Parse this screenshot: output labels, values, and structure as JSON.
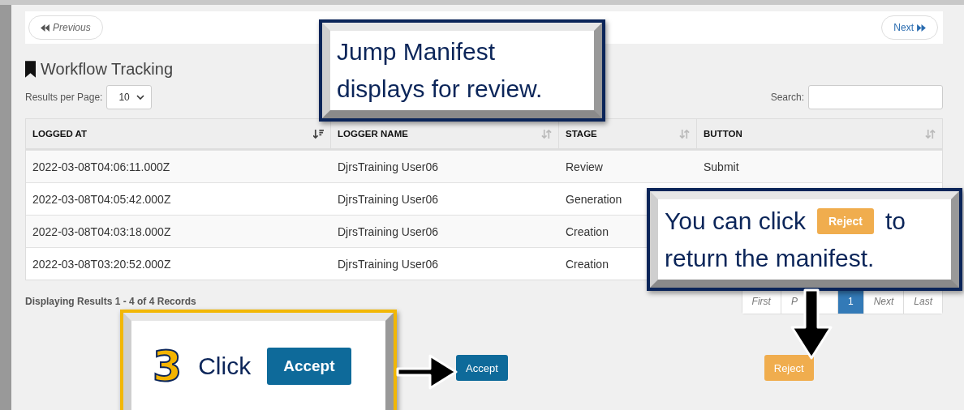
{
  "nav": {
    "previous": "Previous",
    "next": "Next"
  },
  "title": "Workflow Tracking",
  "results_per_page": {
    "label": "Results per Page:",
    "value": "10"
  },
  "search": {
    "label": "Search:"
  },
  "table": {
    "columns": [
      {
        "label": "LOGGED AT",
        "sorted": true
      },
      {
        "label": "LOGGER NAME",
        "sorted": false
      },
      {
        "label": "STAGE",
        "sorted": false
      },
      {
        "label": "BUTTON",
        "sorted": false
      }
    ],
    "rows": [
      {
        "cells": [
          "2022-03-08T04:06:11.000Z",
          "DjrsTraining User06",
          "Review",
          "Submit"
        ]
      },
      {
        "cells": [
          "2022-03-08T04:05:42.000Z",
          "DjrsTraining User06",
          "Generation"
        ]
      },
      {
        "cells": [
          "2022-03-08T04:03:18.000Z",
          "DjrsTraining User06",
          "Creation"
        ]
      },
      {
        "cells": [
          "2022-03-08T03:20:52.000Z",
          "DjrsTraining User06",
          "Creation"
        ]
      }
    ]
  },
  "footer": "Displaying Results 1 - 4 of 4 Records",
  "pager": [
    {
      "label": "First",
      "selected": false
    },
    {
      "label": "P",
      "selected": false
    },
    {
      "label": "1",
      "selected": true
    },
    {
      "label": "Next",
      "selected": false
    },
    {
      "label": "Last",
      "selected": false
    }
  ],
  "actions": [
    {
      "label": "Accept",
      "kind": "accept"
    },
    {
      "label": "Reject",
      "kind": "reject"
    }
  ],
  "callouts": [
    {
      "kind": "note",
      "lines": [
        "Jump Manifest",
        "displays for review."
      ]
    },
    {
      "kind": "hint",
      "before": "You can click",
      "button": "Reject",
      "after": "to",
      "line2": "return the manifest."
    },
    {
      "kind": "step",
      "step": "3",
      "text": "Click",
      "button": "Accept"
    }
  ]
}
